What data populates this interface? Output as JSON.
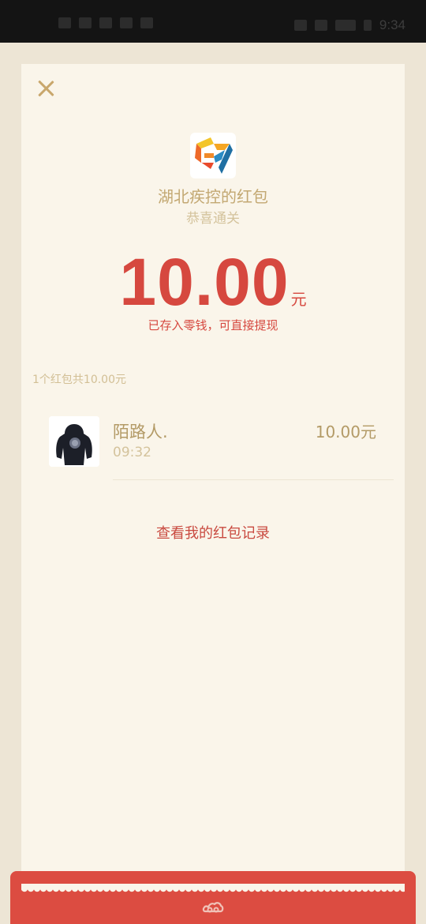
{
  "status_bar": {
    "time": "9:34",
    "left_icons": [
      "nfc-icon",
      "signal-icon",
      "wifi-icon",
      "data-speed-icon",
      "hourglass-icon"
    ],
    "right_icons": [
      "eye-icon",
      "mute-icon",
      "battery-icon",
      "charging-icon"
    ]
  },
  "header": {
    "sender_title": "湖北疾控的红包",
    "subtitle": "恭喜通关",
    "logo_icon": "hubei-cdc-logo-icon"
  },
  "amount": {
    "value": "10.00",
    "unit": "元",
    "note": "已存入零钱，可直接提现"
  },
  "summary": "1个红包共10.00元",
  "records": [
    {
      "name": "陌路人.",
      "time": "09:32",
      "amount": "10.00元"
    }
  ],
  "history_link": "查看我的红包记录",
  "colors": {
    "background": "#ede5d5",
    "card": "#faf5ea",
    "accent_red": "#d6483f",
    "gold": "#c3a872",
    "band_red": "#dc4c41"
  }
}
